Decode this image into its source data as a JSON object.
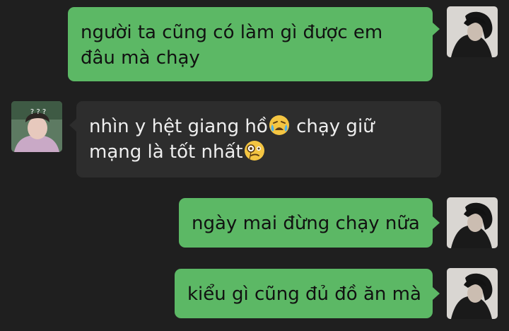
{
  "chat": {
    "messages": [
      {
        "direction": "outgoing",
        "lines": [
          "người ta cũng có làm gì được em",
          "đâu mà chạy"
        ]
      },
      {
        "direction": "incoming",
        "line1_text": "nhìn y hệt giang hồ",
        "line1_after": " chạy giữ",
        "line2_text": "mạng là tốt nhất",
        "emojis": [
          "crying-emoji",
          "monocle-face-emoji"
        ]
      },
      {
        "direction": "outgoing",
        "lines": [
          "ngày mai đừng chạy nữa"
        ]
      },
      {
        "direction": "outgoing",
        "lines": [
          "kiểu gì cũng đủ đồ ăn mà"
        ]
      }
    ],
    "avatars": {
      "self": "dark-hair-portrait",
      "other": "light-hair-portrait",
      "other_caption": "? ? ?"
    },
    "colors": {
      "background": "#1f1f1f",
      "outgoing_bubble": "#5cb865",
      "incoming_bubble": "#2d2d2d"
    }
  }
}
